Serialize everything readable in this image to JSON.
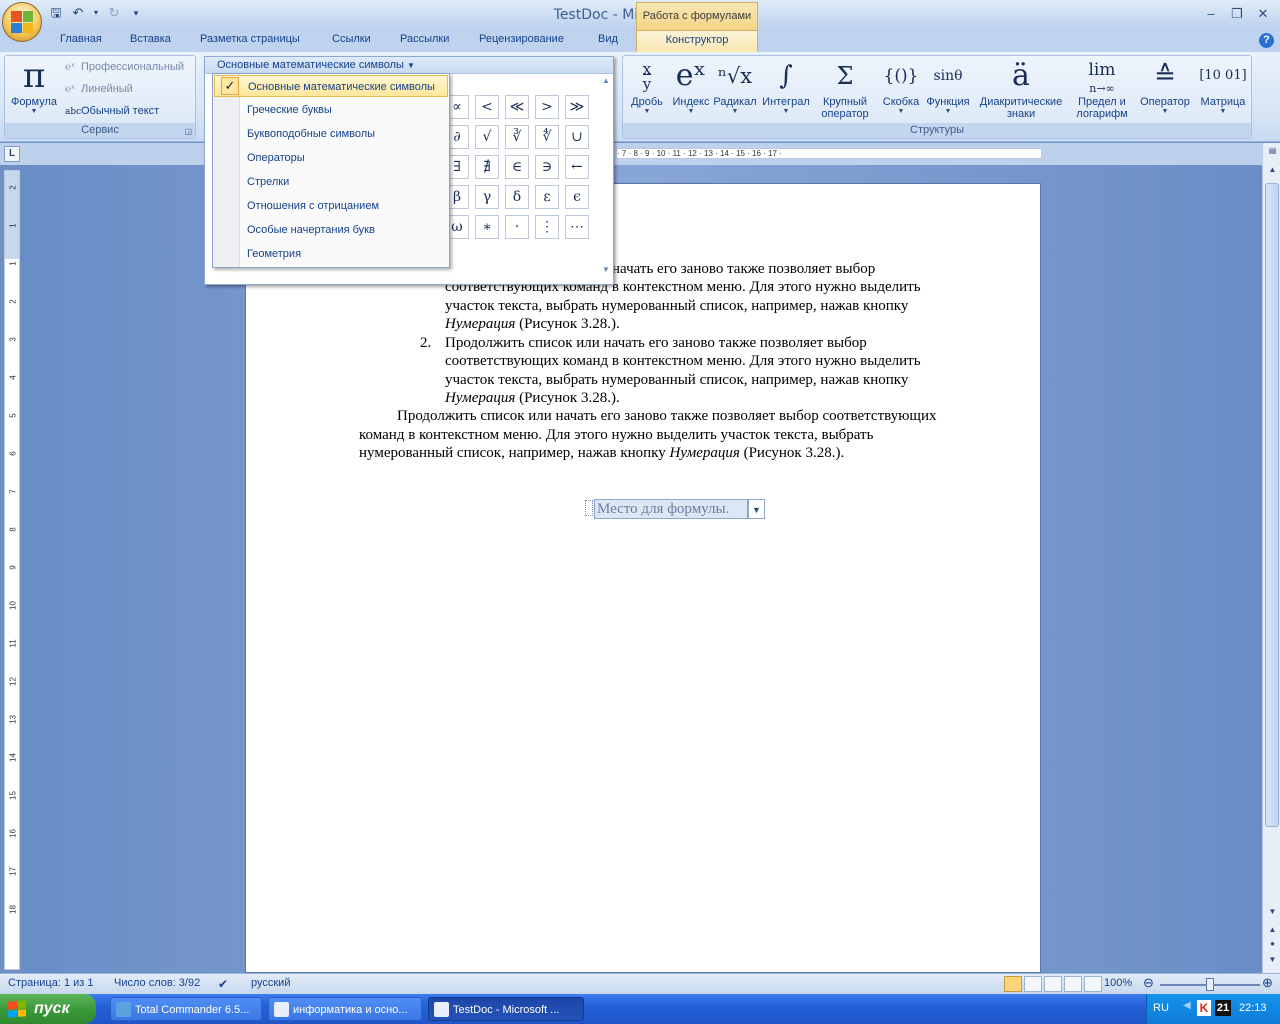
{
  "window": {
    "title": "TestDoc - Microsoft Word",
    "context_group": "Работа с формулами"
  },
  "tabs": [
    "Главная",
    "Вставка",
    "Разметка страницы",
    "Ссылки",
    "Рассылки",
    "Рецензирование",
    "Вид",
    "Конструктор"
  ],
  "ribbon": {
    "service_group": {
      "label": "Сервис",
      "formula": {
        "glyph": "π",
        "label": "Формула"
      },
      "professional": "Профессиональный",
      "linear": "Линейный",
      "normal_text": "Обычный текст",
      "normal_text_icon": "abc"
    },
    "structures_group": {
      "label": "Структуры",
      "buttons": [
        {
          "glyph": "x/y",
          "label": "Дробь"
        },
        {
          "glyph": "eˣ",
          "label": "Индекс"
        },
        {
          "glyph": "ⁿ√x",
          "label": "Радикал"
        },
        {
          "glyph": "∫",
          "label": "Интеграл"
        },
        {
          "glyph": "Σ",
          "label": "Крупный",
          "label2": "оператор"
        },
        {
          "glyph": "{()}",
          "label": "Скобка"
        },
        {
          "glyph": "sinθ",
          "label": "Функция"
        },
        {
          "glyph": "ä",
          "label": "Диакритические",
          "label2": "знаки"
        },
        {
          "glyph": "lim",
          "sub": "n→∞",
          "label": "Предел и",
          "label2": "логарифм"
        },
        {
          "glyph": "≙",
          "label": "Оператор"
        },
        {
          "glyph": "[10 01]",
          "label": "Матрица"
        }
      ]
    },
    "symbols_panel": {
      "selected_category": "Основные математические символы",
      "symbols": [
        "∝",
        "<",
        "≪",
        ">",
        "≫",
        "∂",
        "√",
        "∛",
        "∜",
        "∪",
        "∃",
        "∄",
        "∈",
        "∋",
        "←",
        "β",
        "γ",
        "δ",
        "ε",
        "ϵ",
        "ω",
        "∗",
        "·",
        "⋮",
        "⋯"
      ]
    },
    "category_menu": [
      "Основные математические символы",
      "Греческие буквы",
      "Буквоподобные символы",
      "Операторы",
      "Стрелки",
      "Отношения с отрицанием",
      "Особые начертания букв",
      "Геометрия"
    ]
  },
  "ruler": {
    "horizontal_marks": "· 7 · 8 · 9 · 10 · 11 · 12 · 13 · 14 · 15 · 16 · 17 ·",
    "vertical_marks": [
      "2",
      "1",
      "1",
      "2",
      "3",
      "4",
      "5",
      "6",
      "7",
      "8",
      "9",
      "10",
      "11",
      "12",
      "13",
      "14",
      "15",
      "16",
      "17",
      "18"
    ]
  },
  "document": {
    "item1_lines": [
      "начать его заново также позволяет выбор",
      "соответствующих команд в контекстном меню. Для этого нужно выделить",
      "участок текста, выбрать нумерованный список, например, нажав кнопку"
    ],
    "item1_tail_italic": "Нумерация",
    "item1_tail": " (Рисунок 3.28.).",
    "item2_number": "2.",
    "item2_lines": [
      "Продолжить список или начать его заново также позволяет выбор",
      "соответствующих команд в контекстном меню. Для этого нужно выделить",
      "участок текста, выбрать нумерованный список, например, нажав кнопку"
    ],
    "item2_tail_italic": "Нумерация",
    "item2_tail": " (Рисунок 3.28.).",
    "para_lines": [
      "Продолжить список или начать его заново также позволяет выбор соответствующих",
      "команд в контекстном меню. Для этого нужно выделить участок текста, выбрать"
    ],
    "para_last_prefix": "нумерованный список, например, нажав кнопку ",
    "para_last_italic": "Нумерация",
    "para_last_suffix": " (Рисунок 3.28.).",
    "formula_placeholder": "Место для формулы."
  },
  "statusbar": {
    "page": "Страница: 1 из 1",
    "words": "Число слов: 3/92",
    "language": "русский",
    "zoom": "100%",
    "zoom_fraction": 0.5
  },
  "taskbar": {
    "start": "пуск",
    "tasks": [
      "Total Commander 6.5...",
      "информатика и осно...",
      "TestDoc - Microsoft ..."
    ],
    "tray_lang": "RU",
    "tray_badge": "21",
    "clock": "22:13"
  }
}
